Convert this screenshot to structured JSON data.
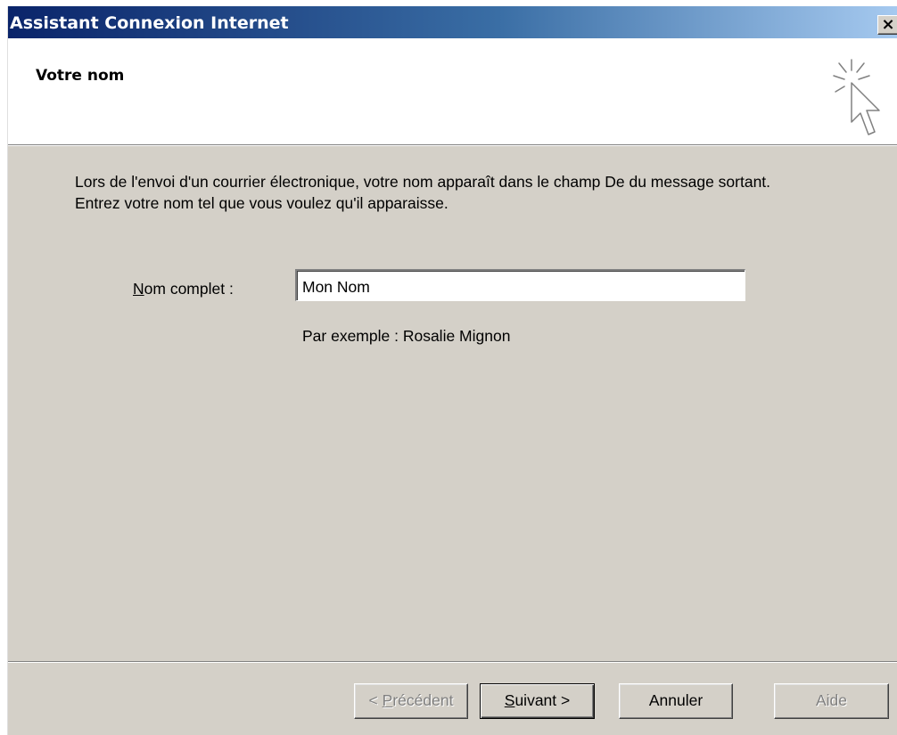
{
  "window": {
    "title": "Assistant Connexion Internet",
    "close_glyph": "×"
  },
  "header": {
    "page_title": "Votre nom",
    "icon": "pointer-sparkle-icon"
  },
  "body": {
    "description": "Lors de l'envoi d'un courrier électronique, votre nom apparaît dans le champ De du message sortant. Entrez votre nom tel que vous voulez qu'il apparaisse.",
    "name_label_mnemonic": "N",
    "name_label_rest": "om complet :",
    "name_value": "Mon Nom",
    "example": "Par exemple : Rosalie Mignon"
  },
  "buttons": {
    "prev_prefix": "< ",
    "prev_mnemonic": "P",
    "prev_rest": "récédent",
    "next_mnemonic": "S",
    "next_rest": "uivant >",
    "cancel": "Annuler",
    "help": "Aide"
  },
  "colors": {
    "titlebar_start": "#0a246a",
    "titlebar_end": "#a6caf0",
    "face": "#d4d0c8"
  }
}
